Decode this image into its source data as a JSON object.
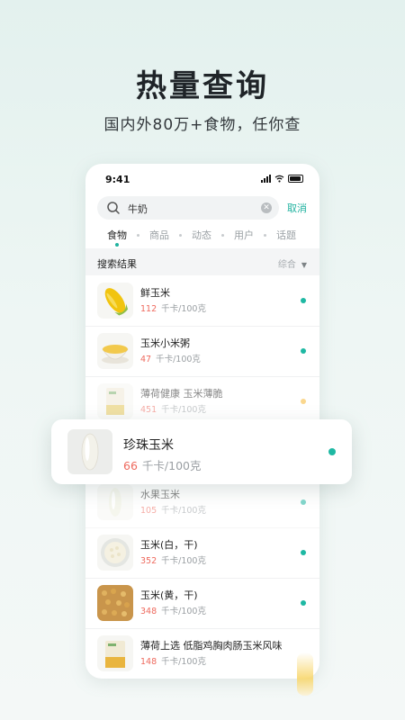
{
  "headline": "热量查询",
  "subheadline": "国内外80万+食物，任你查",
  "status_bar": {
    "time": "9:41"
  },
  "search": {
    "query": "牛奶",
    "cancel_label": "取消"
  },
  "tabs": [
    {
      "label": "食物",
      "active": true
    },
    {
      "label": "商品",
      "active": false
    },
    {
      "label": "动态",
      "active": false
    },
    {
      "label": "用户",
      "active": false
    },
    {
      "label": "话题",
      "active": false
    }
  ],
  "results": {
    "title": "搜索结果",
    "sort_label": "综合"
  },
  "items": [
    {
      "name": "鲜玉米",
      "calories": "112",
      "unit": "千卡/100克",
      "dot": "green"
    },
    {
      "name": "玉米小米粥",
      "calories": "47",
      "unit": "千卡/100克",
      "dot": "green"
    },
    {
      "name": "薄荷健康 玉米薄脆",
      "calories": "451",
      "unit": "千卡/100克",
      "dot": "yellow"
    },
    {
      "name": "水果玉米",
      "calories": "105",
      "unit": "千卡/100克",
      "dot": "green"
    },
    {
      "name": "玉米(白，干)",
      "calories": "352",
      "unit": "千卡/100克",
      "dot": "green"
    },
    {
      "name": "玉米(黄，干)",
      "calories": "348",
      "unit": "千卡/100克",
      "dot": "green"
    },
    {
      "name": "薄荷上选 低脂鸡胸肉肠玉米风味",
      "calories": "148",
      "unit": "千卡/100克",
      "dot": "yellow"
    }
  ],
  "highlight": {
    "name": "珍珠玉米",
    "calories": "66",
    "unit": "千卡/100克",
    "dot": "green"
  },
  "colors": {
    "accent": "#20b29f",
    "calorie_number": "#ee6a5e",
    "dot_yellow": "#f7b733"
  }
}
